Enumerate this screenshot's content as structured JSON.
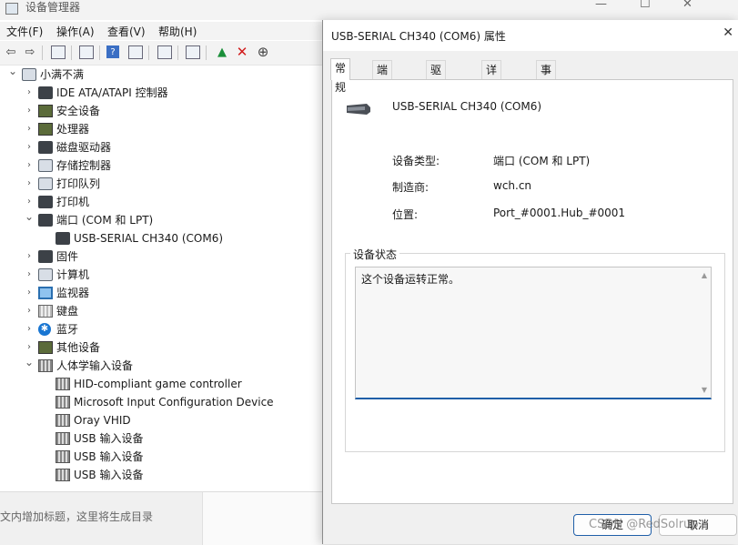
{
  "device_manager": {
    "title": "设备管理器",
    "window_controls": [
      "—",
      "☐",
      "✕"
    ],
    "menu": [
      "文件(F)",
      "操作(A)",
      "查看(V)",
      "帮助(H)"
    ],
    "toolbar_icons": [
      "back-arrow-icon",
      "forward-arrow-icon",
      "show-hide-tree-icon",
      "properties-icon",
      "help-icon",
      "view-icon",
      "update-driver-icon",
      "scan-hardware-icon",
      "enable-device-icon",
      "uninstall-icon",
      "disable-device-icon"
    ],
    "tree": [
      {
        "label": "小满不满",
        "level": 0,
        "expanded": true,
        "icon": "computer-icon"
      },
      {
        "label": "IDE ATA/ATAPI 控制器",
        "level": 1,
        "expanded": false,
        "icon": "ide-controller-icon"
      },
      {
        "label": "安全设备",
        "level": 1,
        "expanded": false,
        "icon": "security-device-icon"
      },
      {
        "label": "处理器",
        "level": 1,
        "expanded": false,
        "icon": "processor-icon"
      },
      {
        "label": "磁盘驱动器",
        "level": 1,
        "expanded": false,
        "icon": "disk-drive-icon"
      },
      {
        "label": "存储控制器",
        "level": 1,
        "expanded": false,
        "icon": "storage-controller-icon"
      },
      {
        "label": "打印队列",
        "level": 1,
        "expanded": false,
        "icon": "print-queue-icon"
      },
      {
        "label": "打印机",
        "level": 1,
        "expanded": false,
        "icon": "printer-icon"
      },
      {
        "label": "端口 (COM 和 LPT)",
        "level": 1,
        "expanded": true,
        "icon": "port-icon"
      },
      {
        "label": "USB-SERIAL CH340 (COM6)",
        "level": 2,
        "expanded": null,
        "icon": "serial-port-icon"
      },
      {
        "label": "固件",
        "level": 1,
        "expanded": false,
        "icon": "firmware-icon"
      },
      {
        "label": "计算机",
        "level": 1,
        "expanded": false,
        "icon": "computer-icon"
      },
      {
        "label": "监视器",
        "level": 1,
        "expanded": false,
        "icon": "monitor-icon"
      },
      {
        "label": "键盘",
        "level": 1,
        "expanded": false,
        "icon": "keyboard-icon"
      },
      {
        "label": "蓝牙",
        "level": 1,
        "expanded": false,
        "icon": "bluetooth-icon"
      },
      {
        "label": "其他设备",
        "level": 1,
        "expanded": false,
        "icon": "other-devices-icon"
      },
      {
        "label": "人体学输入设备",
        "level": 1,
        "expanded": true,
        "icon": "hid-icon"
      },
      {
        "label": "HID-compliant game controller",
        "level": 2,
        "expanded": null,
        "icon": "hid-icon"
      },
      {
        "label": "Microsoft Input Configuration Device",
        "level": 2,
        "expanded": null,
        "icon": "hid-icon"
      },
      {
        "label": "Oray VHID",
        "level": 2,
        "expanded": null,
        "icon": "hid-icon"
      },
      {
        "label": "USB 输入设备",
        "level": 2,
        "expanded": null,
        "icon": "hid-icon"
      },
      {
        "label": "USB 输入设备",
        "level": 2,
        "expanded": null,
        "icon": "hid-icon"
      },
      {
        "label": "USB 输入设备",
        "level": 2,
        "expanded": null,
        "icon": "hid-icon"
      }
    ],
    "background_text": "文内增加标题，这里将生成目录"
  },
  "dialog": {
    "title": "USB-SERIAL CH340 (COM6) 属性",
    "close": "✕",
    "tabs": [
      "常规",
      "端口设置",
      "驱动程序",
      "详细信息",
      "事件"
    ],
    "active_tab": "常规",
    "device_name": "USB-SERIAL CH340 (COM6)",
    "properties": [
      {
        "label": "设备类型:",
        "value": "端口 (COM 和 LPT)"
      },
      {
        "label": "制造商:",
        "value": "wch.cn"
      },
      {
        "label": "位置:",
        "value": "Port_#0001.Hub_#0001"
      }
    ],
    "status_legend": "设备状态",
    "status_text": "这个设备运转正常。",
    "ok_label": "确定",
    "cancel_label": "取消"
  },
  "watermark": "CSDN @RedSolrup",
  "colors": {
    "accent": "#1f5fa8",
    "bluetooth": "#1976d2",
    "uninstall": "#d11a1a",
    "enable": "#1b8f3a"
  }
}
